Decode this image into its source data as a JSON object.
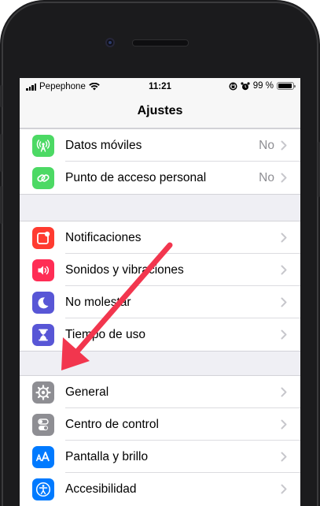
{
  "status_bar": {
    "carrier": "Pepephone",
    "time": "11:21",
    "battery": "99 %"
  },
  "navbar": {
    "title": "Ajustes"
  },
  "groups": [
    {
      "items": [
        {
          "label": "Datos móviles",
          "value": "No",
          "icon": "antenna-icon",
          "color": "#4cd964"
        },
        {
          "label": "Punto de acceso personal",
          "value": "No",
          "icon": "personal-hotspot-icon",
          "color": "#4cd964"
        }
      ]
    },
    {
      "items": [
        {
          "label": "Notificaciones",
          "icon": "notifications-icon",
          "color": "#ff3b30"
        },
        {
          "label": "Sonidos y vibraciones",
          "icon": "speaker-icon",
          "color": "#ff2d55"
        },
        {
          "label": "No molestar",
          "icon": "moon-icon",
          "color": "#5856d6"
        },
        {
          "label": "Tiempo de uso",
          "icon": "hourglass-icon",
          "color": "#5856d6"
        }
      ]
    },
    {
      "items": [
        {
          "label": "General",
          "icon": "gear-icon",
          "color": "#8e8e93"
        },
        {
          "label": "Centro de control",
          "icon": "toggles-icon",
          "color": "#8e8e93"
        },
        {
          "label": "Pantalla y brillo",
          "icon": "text-size-icon",
          "color": "#007aff"
        },
        {
          "label": "Accesibilidad",
          "icon": "accessibility-icon",
          "color": "#007aff"
        }
      ]
    }
  ],
  "annotation": {
    "arrow_color": "#f2364e",
    "points_to": "General"
  }
}
